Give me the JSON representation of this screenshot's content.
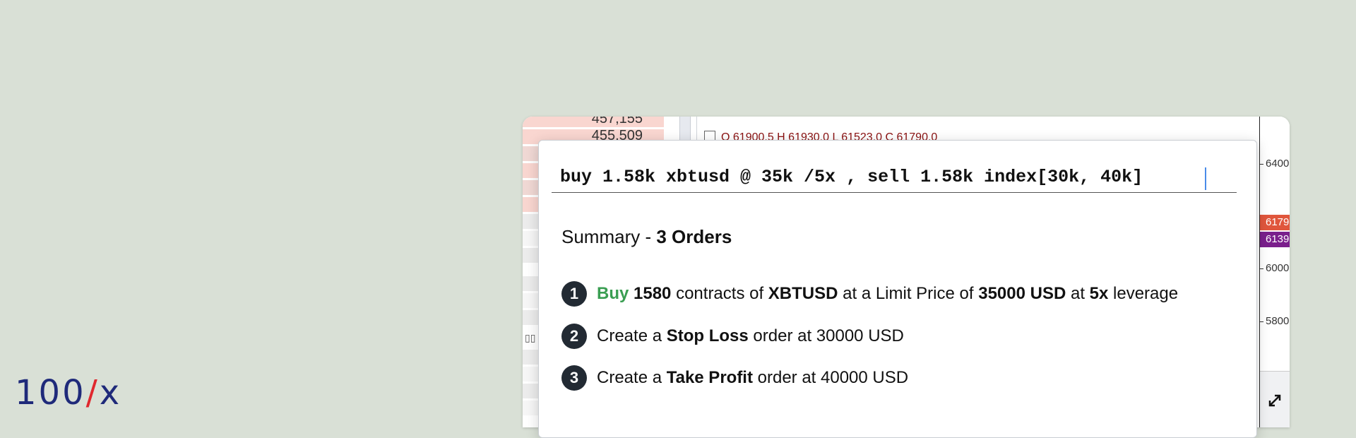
{
  "brand": {
    "part1": "100",
    "slash": "/",
    "part2": "x"
  },
  "orderbook": {
    "values": [
      "457,155",
      "455,509"
    ],
    "icon": "columns-icon"
  },
  "chart": {
    "ohlc_text": "O 61900.5 H 61930.0 L 61523.0 C 61790.0",
    "price_ticks": [
      "6400",
      "6000",
      "5800"
    ],
    "price_tags": [
      {
        "label": "6179",
        "color": "#e0563c"
      },
      {
        "label": "6139",
        "color": "#7a1f8c"
      }
    ]
  },
  "command": {
    "value": "buy 1.58k xbtusd @ 35k /5x , sell 1.58k index[30k, 40k]"
  },
  "summary": {
    "prefix": "Summary - ",
    "count_label": "3 Orders"
  },
  "orders": [
    {
      "num": "1",
      "side": "Buy",
      "qty": "1580",
      "t1": " contracts of ",
      "symbol": "XBTUSD",
      "t2": " at a Limit Price of ",
      "price": "35000 USD",
      "t3": " at ",
      "leverage": "5x",
      "t4": " leverage"
    },
    {
      "num": "2",
      "t1": "Create a ",
      "type": "Stop Loss",
      "t2": " order at 30000 USD"
    },
    {
      "num": "3",
      "t1": "Create a ",
      "type": "Take Profit",
      "t2": " order at 40000 USD"
    }
  ],
  "colors": {
    "background": "#d9e0d6",
    "brand_blue": "#1f2a7a",
    "brand_red": "#e0282e",
    "buy_green": "#3a9e52"
  }
}
